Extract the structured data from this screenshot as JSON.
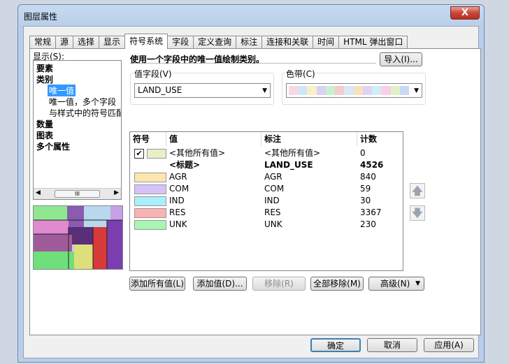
{
  "window": {
    "title": "图层属性",
    "close": "X"
  },
  "tabs": [
    "常规",
    "源",
    "选择",
    "显示",
    "符号系统",
    "字段",
    "定义查询",
    "标注",
    "连接和关联",
    "时间",
    "HTML 弹出窗口"
  ],
  "active_tab": 4,
  "show": {
    "label": "显示(S):",
    "items": [
      "要素",
      "类别",
      "唯一值",
      "唯一值，多个字段",
      "与样式中的符号匹配",
      "数量",
      "图表",
      "多个属性"
    ],
    "scroll_thumb": "III"
  },
  "description": "使用一个字段中的唯一值绘制类别。",
  "import_button": "导入(I)...",
  "value_field": {
    "label": "值字段(V)",
    "value": "LAND_USE"
  },
  "color_ramp": {
    "label": "色带(C)",
    "colors": [
      "#f9d8e0",
      "#cfe6f7",
      "#f7f0c8",
      "#d9d2f3",
      "#c9f0d3",
      "#f5cccd",
      "#d8e8f8",
      "#f8e2bd",
      "#dcd4f5",
      "#cdeffa",
      "#fbcde6",
      "#e1f1c8",
      "#c8d9f7"
    ]
  },
  "table": {
    "headers": {
      "symbol": "符号",
      "value": "值",
      "label": "标注",
      "count": "计数"
    },
    "rows": [
      {
        "color": "#e8f0c6",
        "checked": true,
        "value": "<其他所有值>",
        "label": "<其他所有值>",
        "count": "0",
        "bold": false
      },
      {
        "color": "",
        "checked": false,
        "value": "<标题>",
        "label": "LAND_USE",
        "count": "4526",
        "bold": true
      },
      {
        "color": "#fde5b0",
        "checked": false,
        "value": "AGR",
        "label": "AGR",
        "count": "840",
        "bold": false
      },
      {
        "color": "#d6c2f8",
        "checked": false,
        "value": "COM",
        "label": "COM",
        "count": "59",
        "bold": false
      },
      {
        "color": "#aaeefa",
        "checked": false,
        "value": "IND",
        "label": "IND",
        "count": "30",
        "bold": false
      },
      {
        "color": "#fbb2b5",
        "checked": false,
        "value": "RES",
        "label": "RES",
        "count": "3367",
        "bold": false
      },
      {
        "color": "#a9f5b4",
        "checked": false,
        "value": "UNK",
        "label": "UNK",
        "count": "230",
        "bold": false
      }
    ]
  },
  "side_buttons": {
    "up": "🡅",
    "down": "🡇"
  },
  "actions": {
    "add_all": "添加所有值(L)",
    "add": "添加值(D)...",
    "remove": "移除(R)",
    "remove_all": "全部移除(M)",
    "advanced": "高级(N)"
  },
  "footer": {
    "ok": "确定",
    "cancel": "取消",
    "apply": "应用(A)"
  }
}
